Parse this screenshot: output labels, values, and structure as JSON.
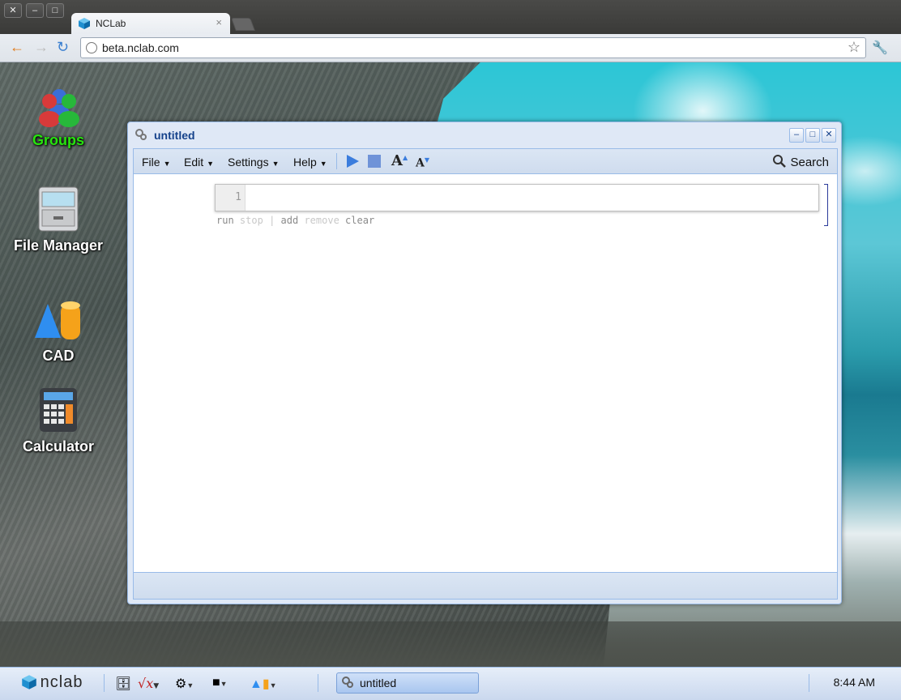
{
  "browser": {
    "window_controls": [
      "✕",
      "–",
      "□"
    ],
    "tab": {
      "title": "NCLab",
      "close": "×"
    },
    "url": "beta.nclab.com"
  },
  "desktop": {
    "icons": [
      {
        "label": "Groups",
        "color": "#27e40e"
      },
      {
        "label": "File Manager"
      },
      {
        "label": "CAD"
      },
      {
        "label": "Calculator"
      }
    ]
  },
  "window": {
    "title": "untitled",
    "menus": [
      "File",
      "Edit",
      "Settings",
      "Help"
    ],
    "search_label": "Search",
    "line_number": "1",
    "actions": {
      "run": "run",
      "stop": "stop",
      "divider": "|",
      "add": "add",
      "remove": "remove",
      "clear": "clear"
    }
  },
  "taskbar": {
    "brand": "nclab",
    "task_label": "untitled",
    "clock": "8:44 AM"
  },
  "colors": {
    "window_border": "#99bbe8",
    "title_text": "#15428b",
    "accent_blue": "#3b7ddd",
    "disabled_text": "#c8c8c8",
    "enabled_text": "#8a8a8a"
  }
}
